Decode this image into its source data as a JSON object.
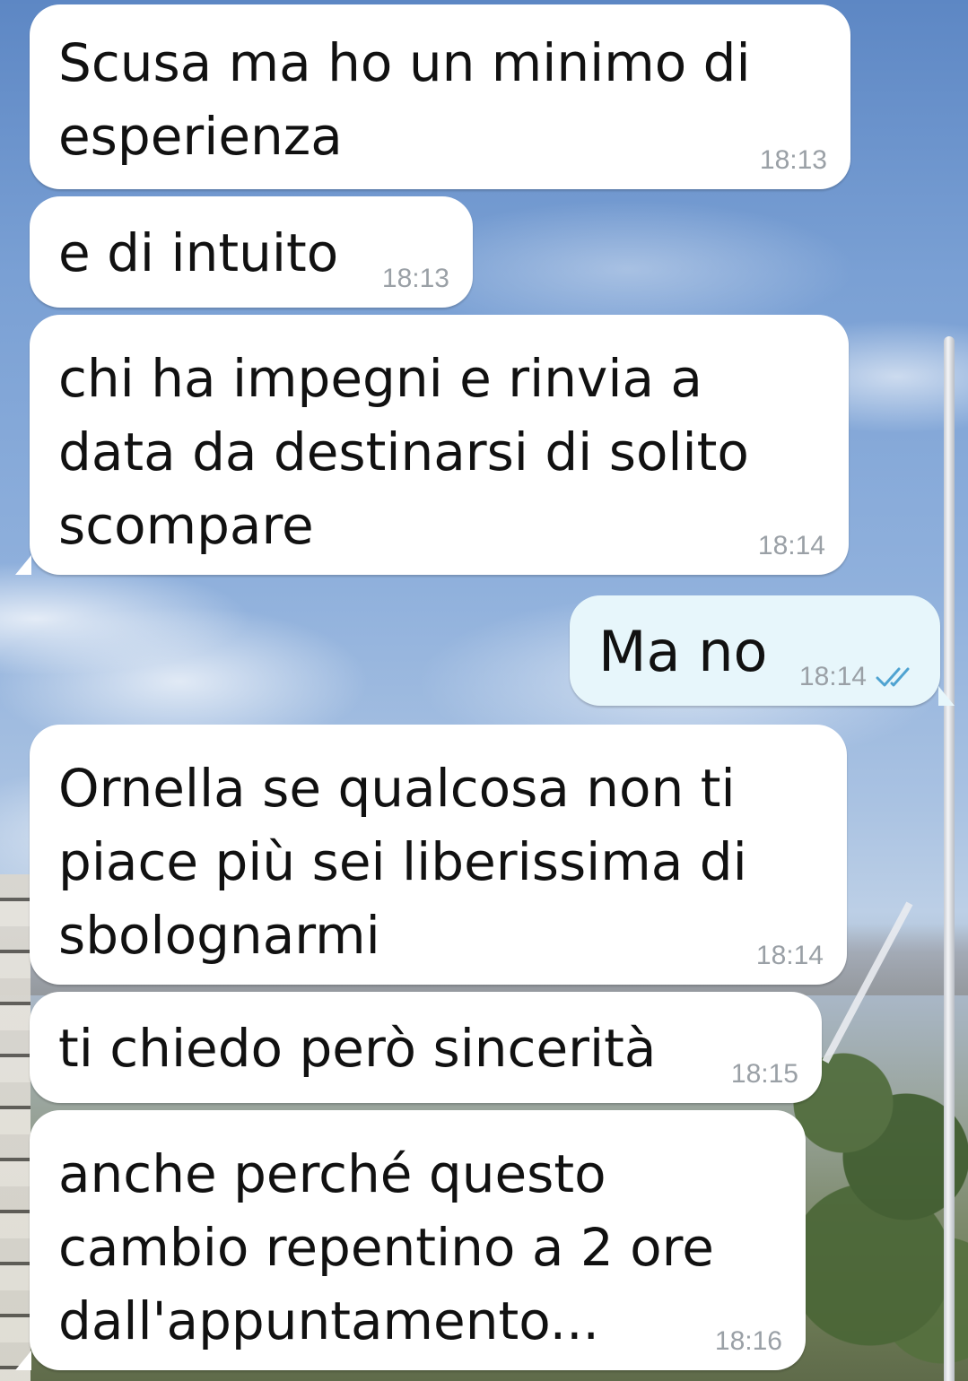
{
  "chat": {
    "messages": [
      {
        "direction": "incoming",
        "text": "Scusa ma ho un minimo di\nesperienza",
        "time": "18:13"
      },
      {
        "direction": "incoming",
        "text": "e di intuito",
        "time": "18:13"
      },
      {
        "direction": "incoming",
        "text": "chi ha impegni e rinvia a\ndata da destinarsi di solito\nscompare",
        "time": "18:14"
      },
      {
        "direction": "outgoing",
        "text": "Ma no",
        "time": "18:14",
        "status_icon": "double-check-icon"
      },
      {
        "direction": "incoming",
        "text": "Ornella se qualcosa non ti\npiace più sei liberissima di\nsbolognarmi",
        "time": "18:14"
      },
      {
        "direction": "incoming",
        "text": "ti chiedo però sincerità",
        "time": "18:15"
      },
      {
        "direction": "incoming",
        "text": "anche perché questo\ncambio repentino a 2 ore\ndall'appuntamento...",
        "time": "18:16"
      }
    ]
  },
  "colors": {
    "incoming_bubble": "#ffffff",
    "outgoing_bubble": "#e7f6fb",
    "timestamp": "#9aa0a6",
    "read_check": "#4fa3d1"
  }
}
